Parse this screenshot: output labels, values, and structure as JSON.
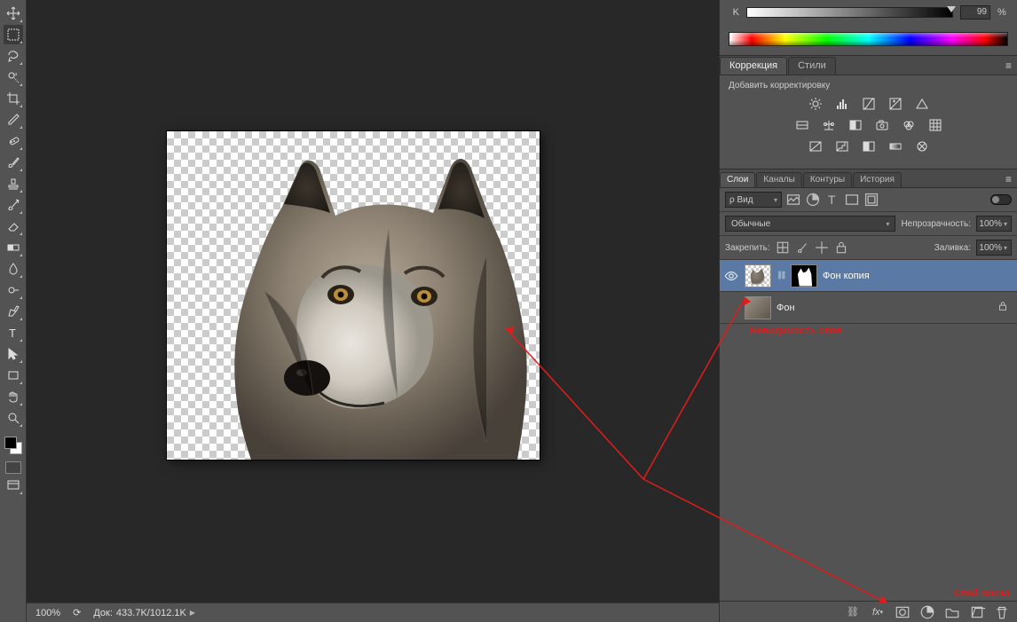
{
  "zoom": "100%",
  "doc_info_label": "Док:",
  "doc_info_value": "433.7K/1012.1K",
  "color": {
    "channel": "K",
    "value": "99",
    "pct": "%"
  },
  "adjustments": {
    "tab_correction": "Коррекция",
    "tab_styles": "Стили",
    "add_label": "Добавить корректировку"
  },
  "layers_tabs": {
    "layers": "Слои",
    "channels": "Каналы",
    "paths": "Контуры",
    "history": "История"
  },
  "filter_label": "ρ Вид",
  "blend_mode": "Обычные",
  "opacity_label": "Непрозрачность:",
  "opacity_value": "100%",
  "lock_label": "Закрепить:",
  "fill_label": "Заливка:",
  "fill_value": "100%",
  "layer1_name": "Фон копия",
  "layer2_name": "Фон",
  "annotation_visibility": "Невидимость слоя",
  "annotation_mask": "Слой-маска"
}
